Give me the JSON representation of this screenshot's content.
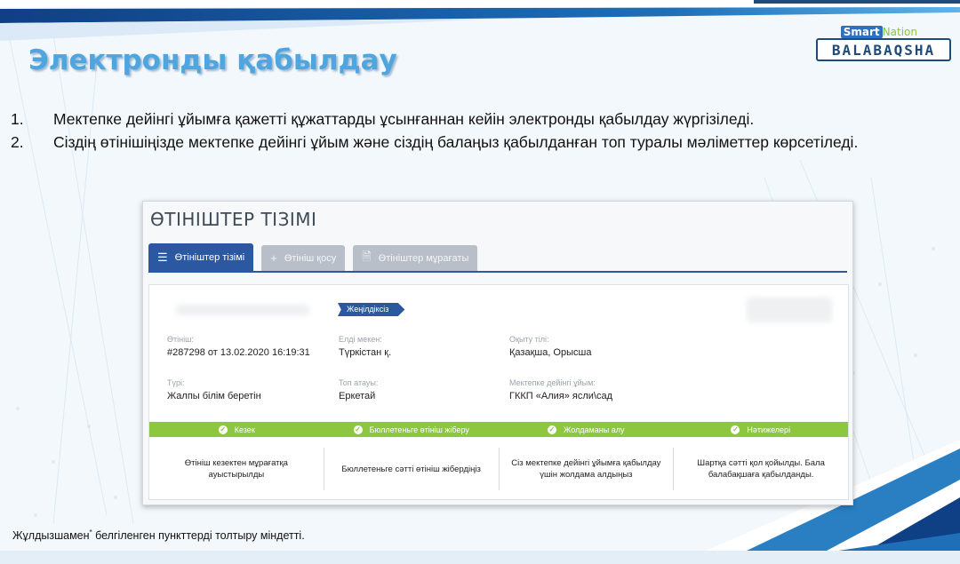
{
  "slide": {
    "title": "Электронды қабылдау",
    "logo_smart": "Smart",
    "logo_nation": "Nation",
    "logo_main": "BALABAQSHA"
  },
  "steps": [
    {
      "num": "1.",
      "text": "Мектепке дейінгі ұйымға қажетті құжаттарды ұсынғаннан кейін электронды қабылдау жүргізіледі."
    },
    {
      "num": "2.",
      "text": "Сіздің өтінішіңізде мектепке дейінгі ұйым және сіздің балаңыз қабылданған топ туралы мәліметтер көрсетіледі."
    }
  ],
  "app": {
    "title": "ӨТІНІШТЕР ТІЗІМІ",
    "tabs": [
      {
        "label": "Өтініштер тізімі",
        "icon": "list-icon",
        "glyph": "☰"
      },
      {
        "label": "Өтініш қосу",
        "icon": "plus-icon",
        "glyph": "+"
      },
      {
        "label": "Өтініштер мұрағаты",
        "icon": "document-icon",
        "glyph": "🗎"
      }
    ],
    "status_badge": "Жеңілдіксіз",
    "fields": {
      "application": {
        "label": "Өтініш:",
        "value": "#287298 от 13.02.2020 16:19:31"
      },
      "settlement": {
        "label": "Елді мекен:",
        "value": "Түркістан қ."
      },
      "language": {
        "label": "Оқыту тілі:",
        "value": "Қазақша, Орысша"
      },
      "type": {
        "label": "Түрі:",
        "value": "Жалпы білім беретін"
      },
      "group": {
        "label": "Топ атауы:",
        "value": "Еркетай"
      },
      "organization": {
        "label": "Мектепке дейінгі ұйым:",
        "value": "ГККП «Алия» ясли\\сад"
      }
    },
    "progress_steps": [
      "Кезек",
      "Бюллетеньге өтініш жіберу",
      "Жолдаманы алу",
      "Нәтижелері"
    ],
    "results": [
      "Өтініш кезектен мұрағатқа ауыстырылды",
      "Бюллетеньге сәтті өтініш жібердіңіз",
      "Сіз мектепке дейінгі ұйымға қабылдау үшін жолдама алдыңыз",
      "Шартқа сәтті қол қойылды. Бала балабақшаға қабылданды."
    ]
  },
  "footnote": {
    "text": "Жұлдызшамен",
    "mark": "*",
    "text_after": " белгіленген пункттерді толтыру міндетті."
  },
  "colors": {
    "title_blue": "#4fa6df",
    "accent_blue": "#2c58a2",
    "success_green": "#8dc63f",
    "navy": "#1f4b7a"
  }
}
